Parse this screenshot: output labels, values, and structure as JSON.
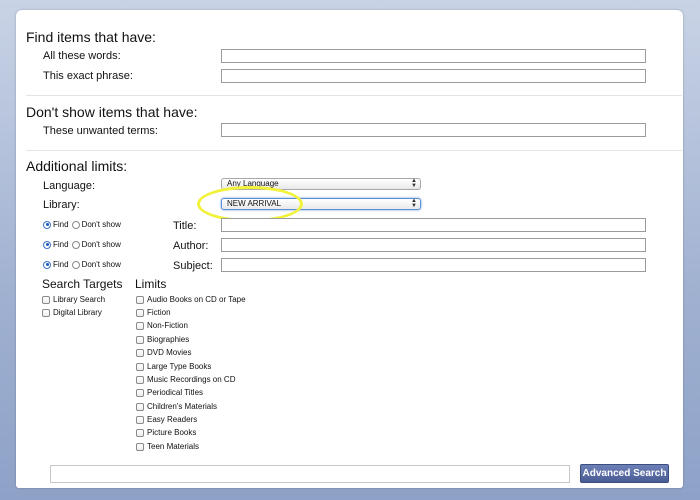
{
  "find_section": {
    "title": "Find items that have:",
    "all_words_label": "All these words:",
    "all_words_value": "",
    "exact_phrase_label": "This exact phrase:",
    "exact_phrase_value": ""
  },
  "exclude_section": {
    "title": "Don't show items that have:",
    "unwanted_label": "These unwanted terms:",
    "unwanted_value": ""
  },
  "limits_section": {
    "title": "Additional limits:",
    "language_label": "Language:",
    "language_value": "Any Language",
    "library_label": "Library:",
    "library_value": "NEW ARRIVAL",
    "field_rows": [
      {
        "find": "Find",
        "dont": "Don't show",
        "label": "Title:",
        "value": ""
      },
      {
        "find": "Find",
        "dont": "Don't show",
        "label": "Author:",
        "value": ""
      },
      {
        "find": "Find",
        "dont": "Don't show",
        "label": "Subject:",
        "value": ""
      }
    ]
  },
  "search_targets": {
    "title": "Search Targets",
    "items": [
      "Library Search",
      "Digital Library"
    ]
  },
  "limits": {
    "title": "Limits",
    "items": [
      "Audio Books on CD or Tape",
      "Fiction",
      "Non-Fiction",
      "Biographies",
      "DVD Movies",
      "Large Type Books",
      "Music Recordings on CD",
      "Periodical Titles",
      "Children's Materials",
      "Easy Readers",
      "Picture Books",
      "Teen Materials"
    ]
  },
  "footer": {
    "search_value": "",
    "button_label": "Advanced Search"
  },
  "colors": {
    "highlight": "#f2f23a",
    "button": "#4a5c94",
    "background_gradient_end": "#8ea2c8"
  }
}
